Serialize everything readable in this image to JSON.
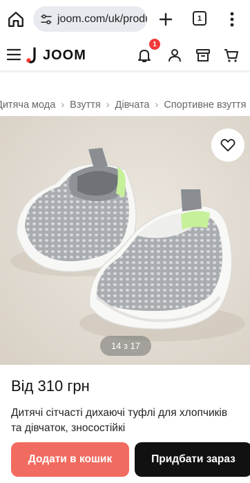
{
  "browser": {
    "url": "joom.com/uk/products/",
    "tab_count": "1"
  },
  "header": {
    "logo_text": "JOOM",
    "notification_count": "1"
  },
  "breadcrumbs": [
    "Дитяча мода",
    "Взуття",
    "Дівчата",
    "Спортивне взуття"
  ],
  "gallery": {
    "counter": "14 з 17"
  },
  "product": {
    "price": "Від 310 грн",
    "title": "Дитячі сітчасті дихаючі туфлі для хлопчиків та дівчаток, зносостійкі"
  },
  "actions": {
    "add_to_cart": "Додати в кошик",
    "buy_now": "Придбати зараз"
  },
  "colors": {
    "accent": "#f26b60",
    "badge": "#f0393a",
    "logo_red": "#ff3a2f",
    "shoe_green": "#c6f09a"
  }
}
